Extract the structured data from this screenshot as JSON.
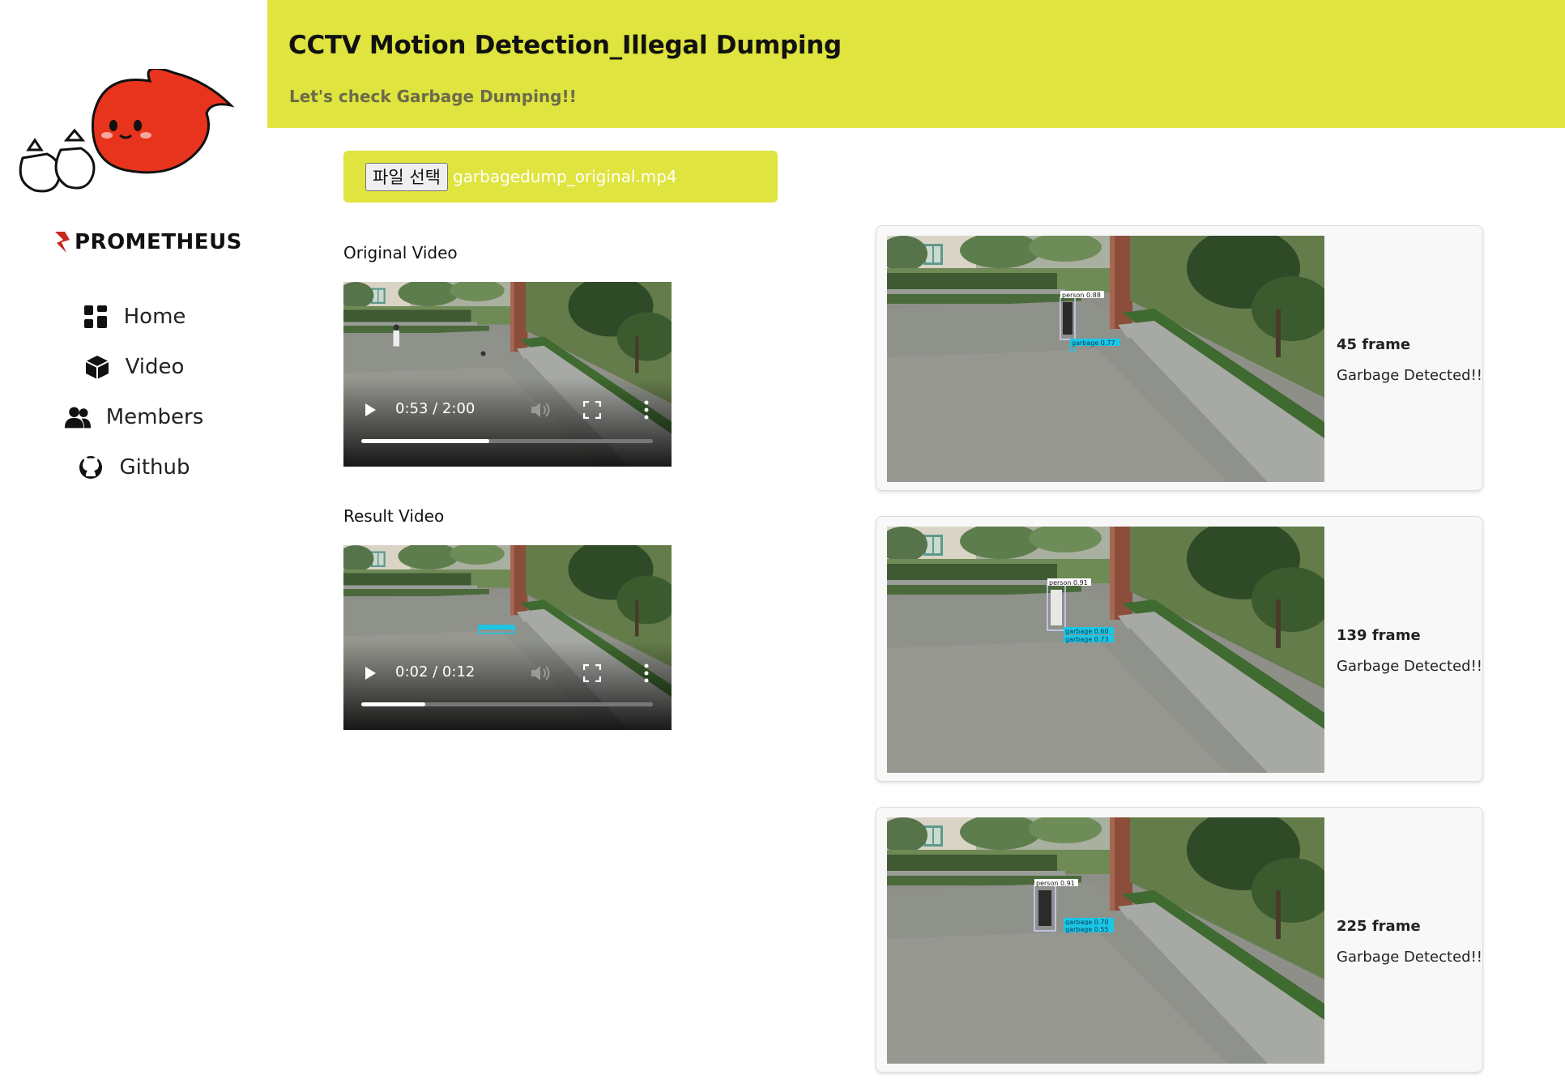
{
  "sidebar": {
    "brand": "PROMETHEUS",
    "items": [
      {
        "label": "Home",
        "icon": "dashboard-icon"
      },
      {
        "label": "Video",
        "icon": "cube-icon"
      },
      {
        "label": "Members",
        "icon": "users-icon"
      },
      {
        "label": "Github",
        "icon": "github-icon"
      }
    ]
  },
  "header": {
    "title": "CCTV Motion Detection_Illegal Dumping",
    "subtitle": "Let's check Garbage Dumping!!",
    "background_color": "#dfe43e"
  },
  "upload": {
    "button_label": "파일 선택",
    "file_name": "garbagedump_original.mp4"
  },
  "original_video": {
    "label": "Original Video",
    "time": "0:53 / 2:00",
    "progress": 0.44
  },
  "result_video": {
    "label": "Result Video",
    "time": "0:02 / 0:12",
    "progress": 0.22
  },
  "detections": [
    {
      "frame": "45 frame",
      "status": "Garbage Detected!!",
      "boxes": [
        {
          "label": "person 0.88",
          "type": "person"
        },
        {
          "label": "garbage 0.77",
          "type": "garbage"
        }
      ]
    },
    {
      "frame": "139 frame",
      "status": "Garbage Detected!!",
      "boxes": [
        {
          "label": "person 0.91",
          "type": "person"
        },
        {
          "label": "garbage 0.60",
          "type": "garbage"
        },
        {
          "label": "garbage 0.73",
          "type": "garbage"
        }
      ]
    },
    {
      "frame": "225 frame",
      "status": "Garbage Detected!!",
      "boxes": [
        {
          "label": "person 0.91",
          "type": "person"
        },
        {
          "label": "garbage 0.70",
          "type": "garbage"
        },
        {
          "label": "garbage 0.55",
          "type": "garbage"
        }
      ]
    }
  ]
}
